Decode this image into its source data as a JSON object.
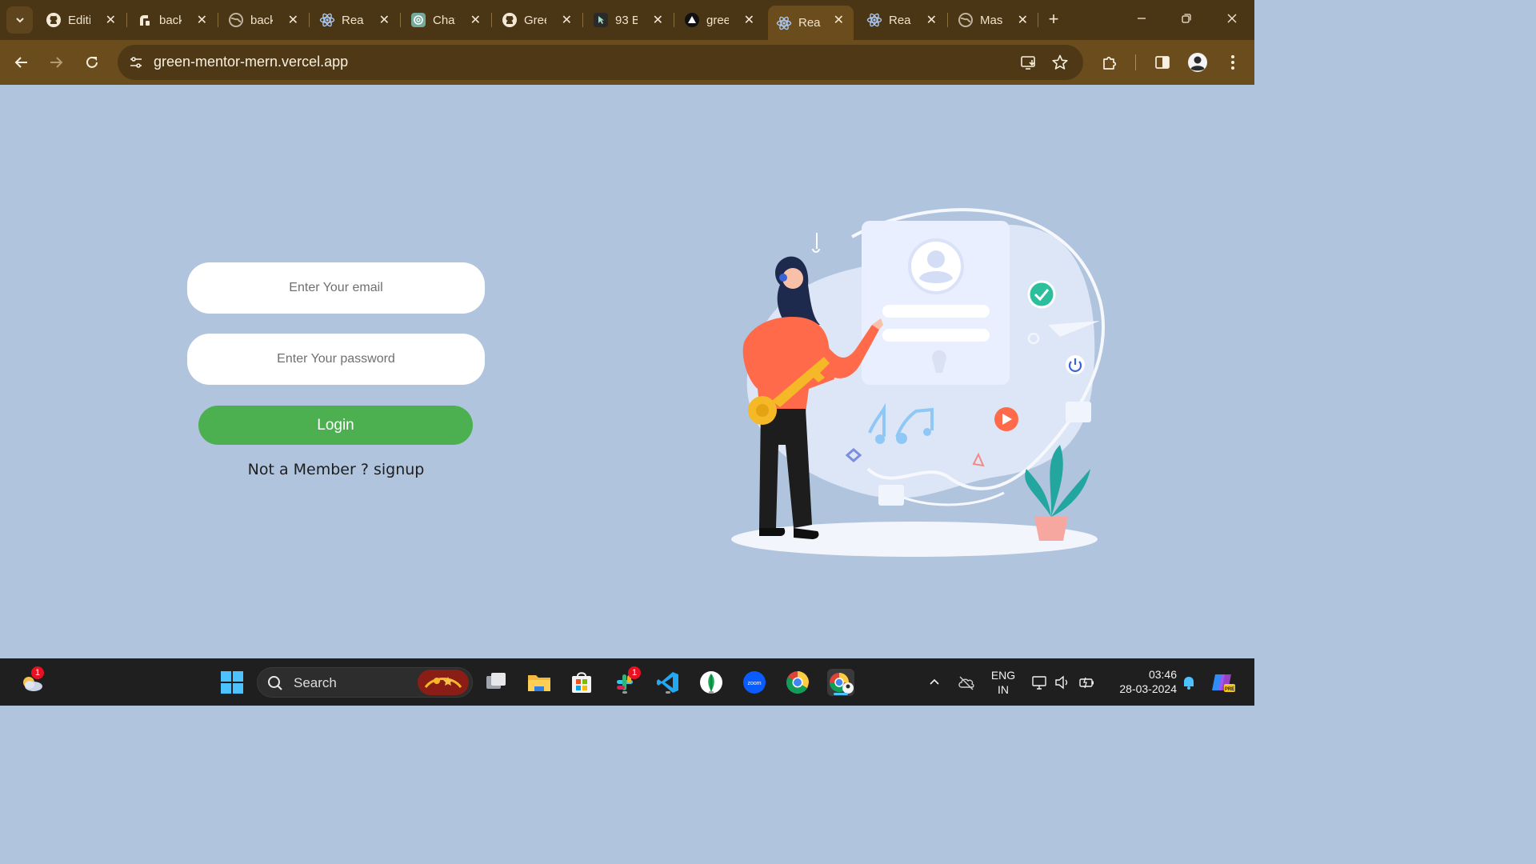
{
  "browser": {
    "tabs": [
      {
        "label": "Editi",
        "icon": "github-icon"
      },
      {
        "label": "back",
        "icon": "render-icon"
      },
      {
        "label": "back",
        "icon": "globe-icon"
      },
      {
        "label": "Reac",
        "icon": "react-icon"
      },
      {
        "label": "Chat",
        "icon": "chatgpt-icon"
      },
      {
        "label": "Gree",
        "icon": "github-icon"
      },
      {
        "label": "93 B",
        "icon": "cursor-icon"
      },
      {
        "label": "gree",
        "icon": "vercel-icon"
      },
      {
        "label": "Reac",
        "icon": "react-icon",
        "active": true
      },
      {
        "label": "Reac",
        "icon": "react-icon"
      },
      {
        "label": "Mas",
        "icon": "globe-icon"
      }
    ],
    "close_glyph": "✕",
    "new_tab_glyph": "+",
    "url": "green-mentor-mern.vercel.app"
  },
  "login": {
    "email_placeholder": "Enter Your email",
    "password_placeholder": "Enter Your password",
    "button_label": "Login",
    "signup_prompt": "Not a Member ?",
    "signup_link": "signup"
  },
  "taskbar": {
    "search_label": "Search",
    "weather_badge": "1",
    "slack_badge": "1",
    "language_line1": "ENG",
    "language_line2": "IN",
    "time": "03:46",
    "date": "28-03-2024"
  },
  "colors": {
    "page_background": "#b0c4de",
    "login_button": "#4caf50",
    "browser_frame": "#4a3514",
    "browser_toolbar": "#6b4c1c"
  }
}
